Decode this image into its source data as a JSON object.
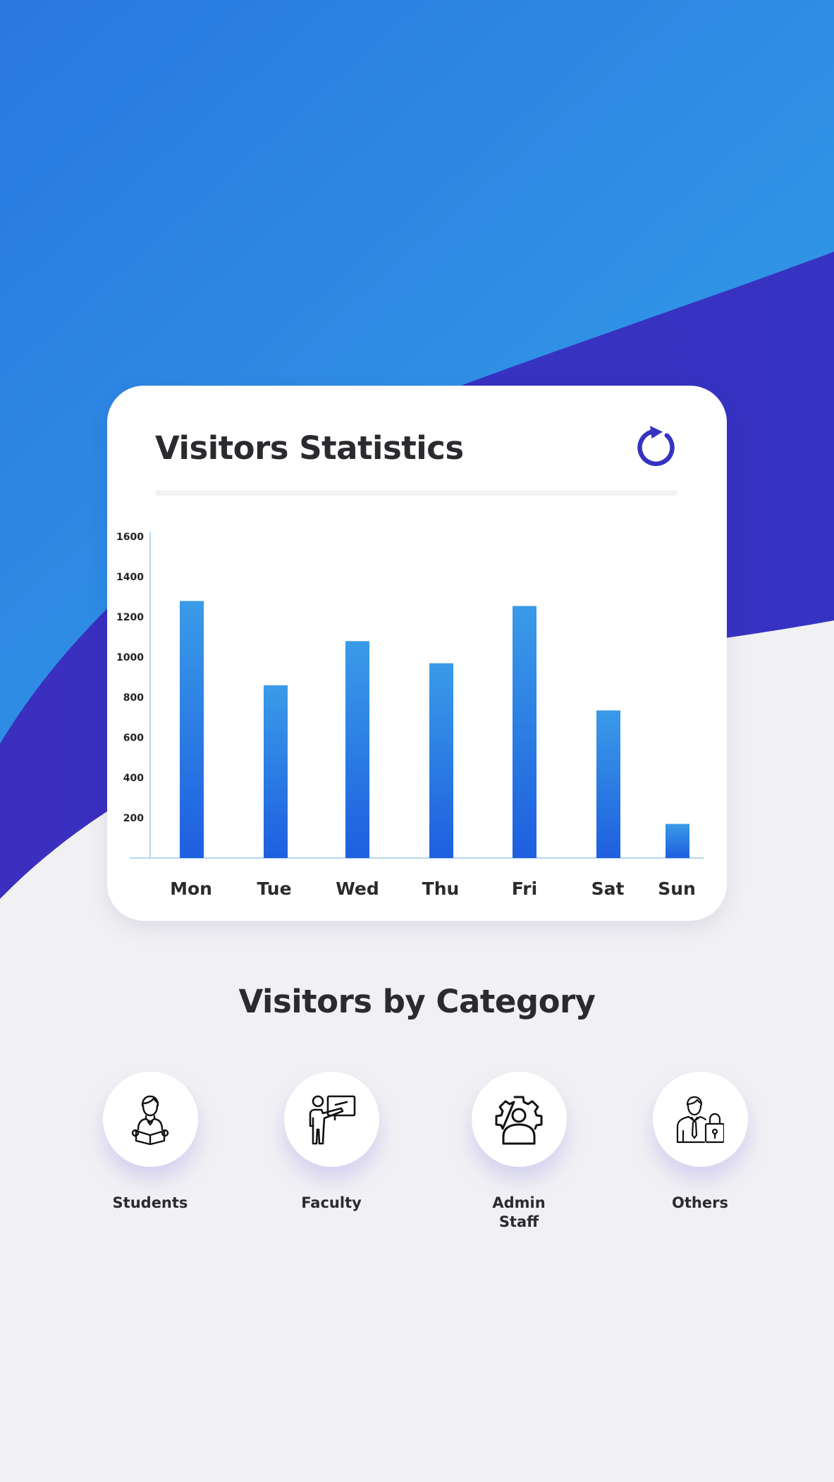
{
  "colors": {
    "background": "#f1f1f4",
    "accent_blue": "#2d83e4",
    "accent_indigo": "#3733c0",
    "bar_top": "#3a9be8",
    "bar_bottom": "#1e5fdf",
    "text": "#2b2b2f"
  },
  "card": {
    "title": "Visitors Statistics",
    "refresh_icon": "refresh-icon"
  },
  "chart_data": {
    "type": "bar",
    "title": "Visitors Statistics",
    "xlabel": "",
    "ylabel": "",
    "categories": [
      "Mon",
      "Tue",
      "Wed",
      "Thu",
      "Fri",
      "Sat",
      "Sun"
    ],
    "values": [
      1280,
      860,
      1080,
      970,
      1255,
      735,
      170
    ],
    "ylim": [
      0,
      1650
    ],
    "yticks": [
      200,
      400,
      600,
      800,
      1000,
      1200,
      1400,
      1600
    ],
    "grid": false,
    "legend": "none"
  },
  "categories_section": {
    "title": "Visitors by Category",
    "items": [
      {
        "label": "Students",
        "icon": "student-reading-icon"
      },
      {
        "label": "Faculty",
        "icon": "teacher-board-icon"
      },
      {
        "label": "Admin\nStaff",
        "icon": "gear-user-icon"
      },
      {
        "label": "Others",
        "icon": "person-lock-icon"
      }
    ]
  }
}
